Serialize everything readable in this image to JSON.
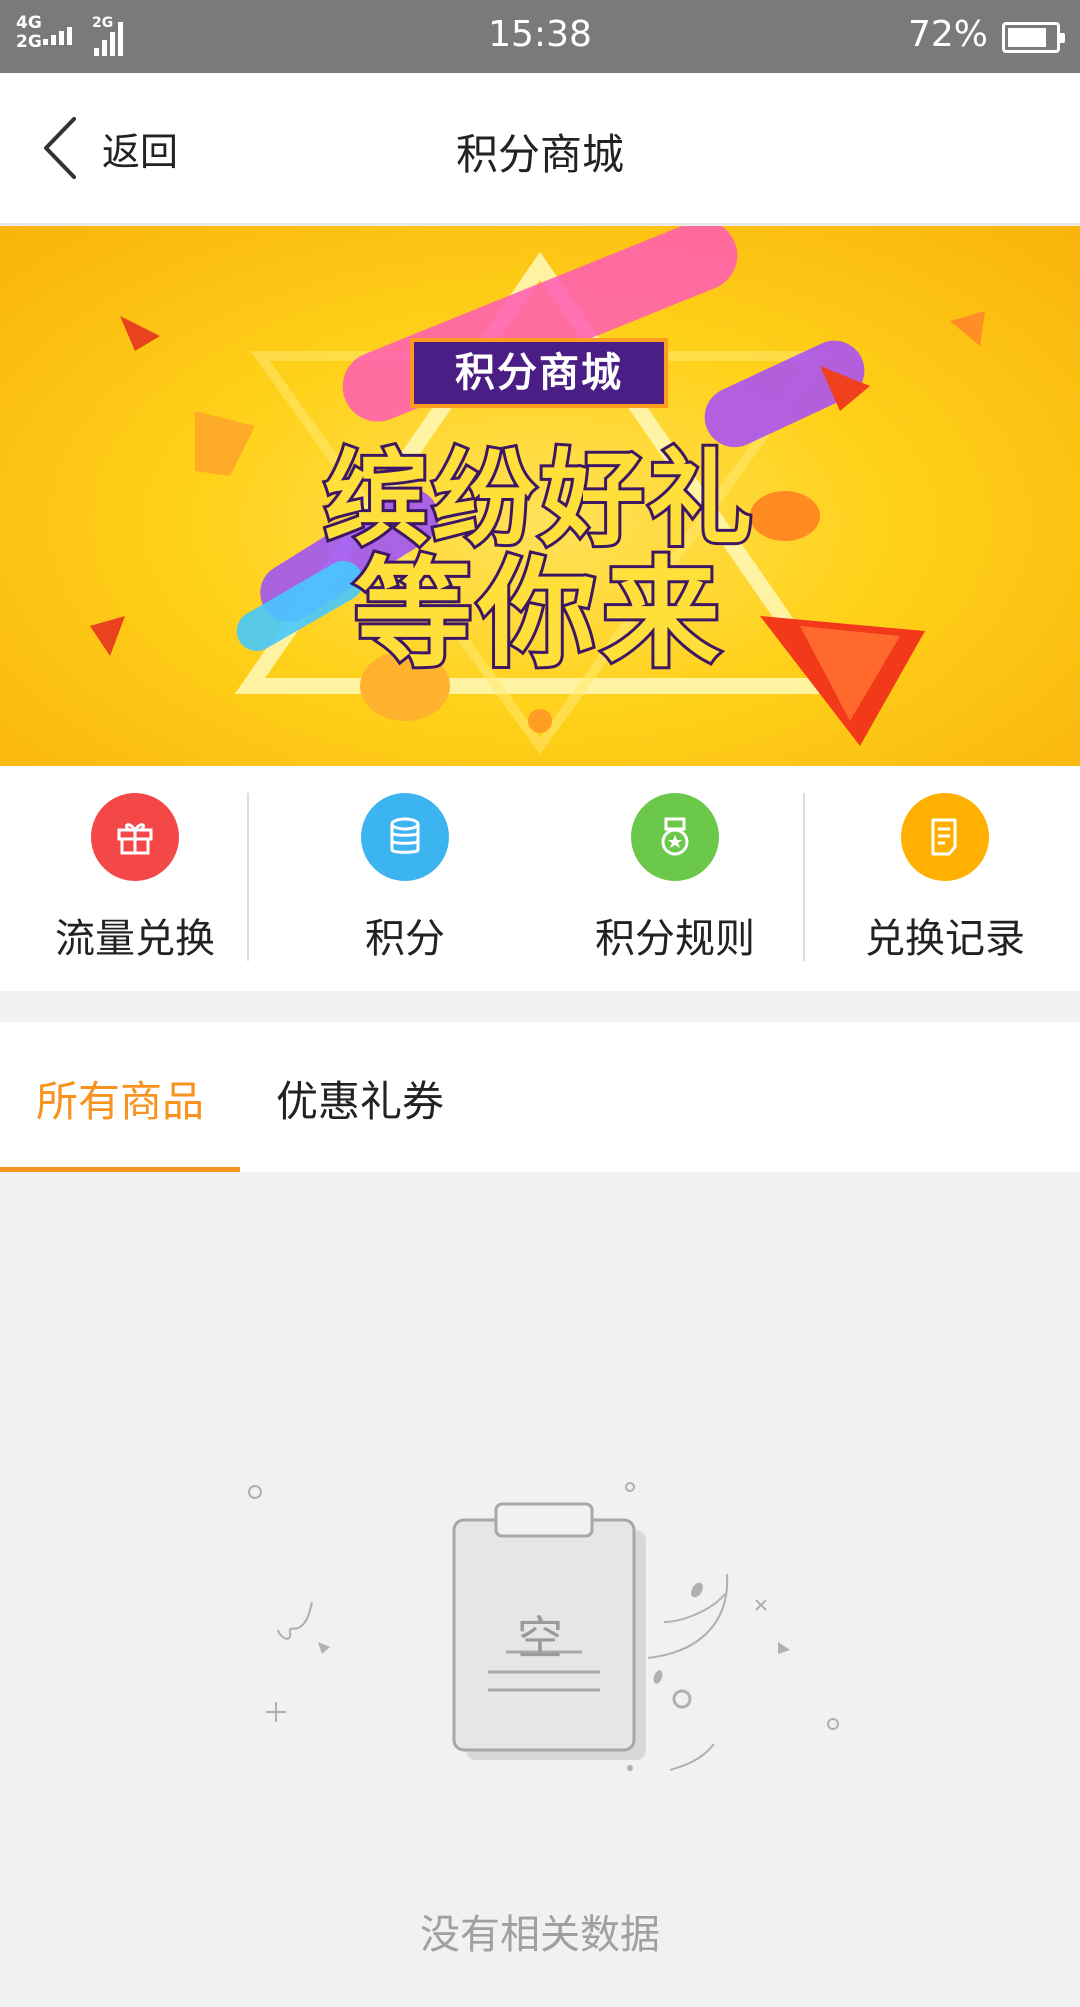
{
  "status_bar": {
    "net1": "4G",
    "net2": "2G",
    "net3": "2G",
    "time": "15:38",
    "battery": "72%"
  },
  "header": {
    "back_label": "返回",
    "title": "积分商城"
  },
  "banner": {
    "badge": "积分商城",
    "line1": "缤纷好礼",
    "line2": "等你来"
  },
  "shortcuts": [
    {
      "label": "流量兑换",
      "icon": "gift-icon",
      "color": "#f44848"
    },
    {
      "label": "积分",
      "icon": "coins-icon",
      "color": "#3cb4f0"
    },
    {
      "label": "积分规则",
      "icon": "medal-icon",
      "color": "#6cc84a"
    },
    {
      "label": "兑换记录",
      "icon": "record-icon",
      "color": "#ffb000"
    }
  ],
  "tabs": {
    "all_products": "所有商品",
    "coupons": "优惠礼券"
  },
  "empty_state": {
    "clipboard_word": "空",
    "message": "没有相关数据"
  },
  "colors": {
    "accent": "#f7931e",
    "status_bar": "#7a7a7a"
  }
}
